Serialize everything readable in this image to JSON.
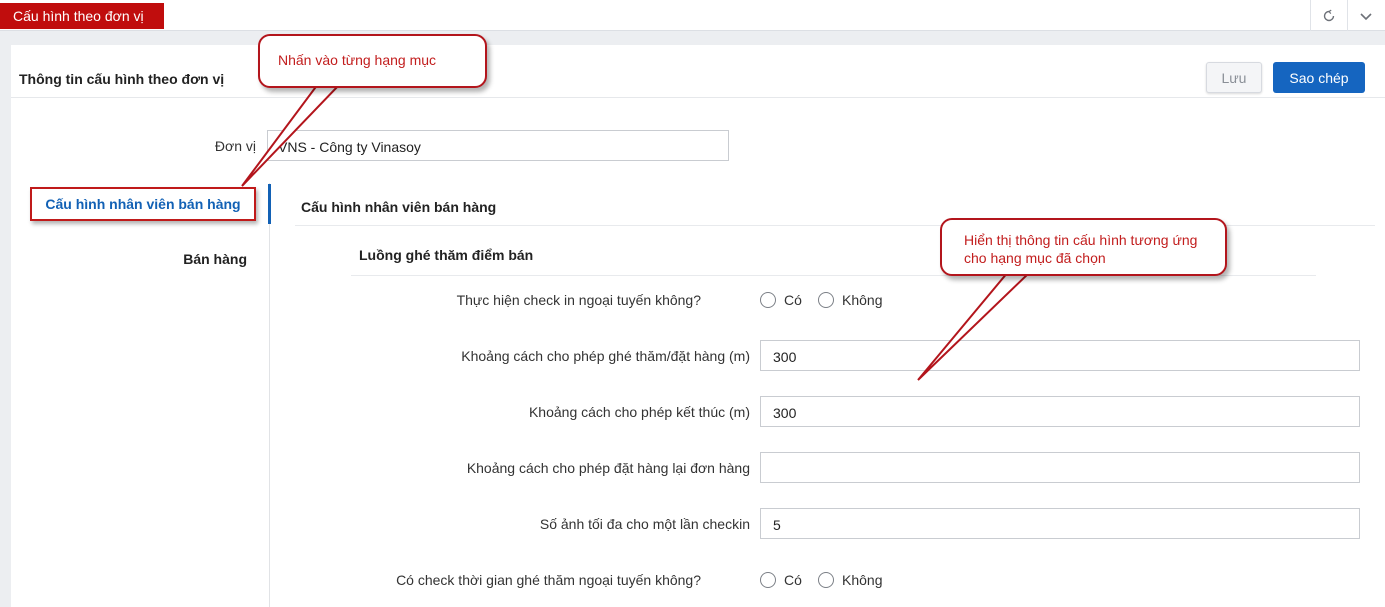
{
  "topbar": {
    "active_tab": "Cấu hình theo đơn vị",
    "refresh_icon": "refresh-icon",
    "collapse_icon": "chevron-down-icon"
  },
  "panel": {
    "title": "Thông tin cấu hình theo đơn vị",
    "save_label": "Lưu",
    "copy_label": "Sao chép"
  },
  "unit": {
    "label": "Đơn vị",
    "value": "VNS - Công ty Vinasoy"
  },
  "sidebar": {
    "items": [
      {
        "label": "Cấu hình nhân viên bán hàng",
        "active": true
      },
      {
        "label": "Bán hàng",
        "active": false
      }
    ]
  },
  "section": {
    "title": "Cấu hình nhân viên bán hàng",
    "subsection_title": "Luồng ghé thăm điểm bán",
    "fields": [
      {
        "label": "Thực hiện check in ngoại tuyến không?",
        "type": "radio",
        "options": [
          "Có",
          "Không"
        ]
      },
      {
        "label": "Khoảng cách cho phép ghé thăm/đặt hàng (m)",
        "type": "input",
        "value": "300"
      },
      {
        "label": "Khoảng cách cho phép kết thúc (m)",
        "type": "input",
        "value": "300"
      },
      {
        "label": "Khoảng cách cho phép đặt hàng lại đơn hàng",
        "type": "input",
        "value": ""
      },
      {
        "label": "Số ảnh tối đa cho một lần checkin",
        "type": "input",
        "value": "5"
      },
      {
        "label": "Có check thời gian ghé thăm ngoại tuyến không?",
        "type": "radio",
        "options": [
          "Có",
          "Không"
        ]
      }
    ]
  },
  "callouts": {
    "left": "Nhấn vào từng hạng mục",
    "right": "Hiển thị thông tin cấu hình tương ứng cho hạng mục đã chọn"
  },
  "colors": {
    "brand_red": "#c00d0d",
    "primary_blue": "#1565c0",
    "callout_red": "#b3151c"
  }
}
